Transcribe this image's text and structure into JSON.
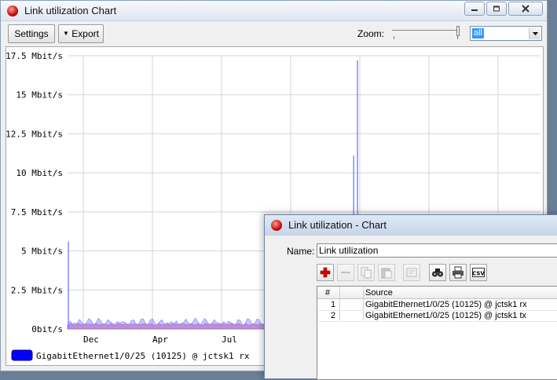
{
  "main_window": {
    "title": "Link utilization Chart",
    "toolbar": {
      "settings_label": "Settings",
      "export_label": "Export",
      "zoom_label": "Zoom:",
      "zoom_value": "all",
      "zoom_slider_fraction": 1.0
    }
  },
  "chart_data": {
    "type": "area",
    "y_tick_labels": [
      "0bit/s",
      "2.5 Mbit/s",
      "5 Mbit/s",
      "7.5 Mbit/s",
      "10 Mbit/s",
      "12.5 Mbit/s",
      "15 Mbit/s",
      "17.5 Mbit/s"
    ],
    "ylim": [
      0,
      17.5
    ],
    "y_unit": "Mbit/s",
    "x_tick_labels": [
      "Dec",
      "Apr",
      "Jul"
    ],
    "grid": true,
    "legend_position": "bottom-left",
    "legend": [
      {
        "name": "GigabitEthernet1/0/25 (10125) @ jctsk1 rx",
        "color": "#0000ff"
      }
    ],
    "series": [
      {
        "name": "GigabitEthernet1/0/25 (10125) @ jctsk1 rx",
        "color": "#7f7fff",
        "peaks": [
          {
            "x": 0.0,
            "y": 5.6
          },
          {
            "x": 0.605,
            "y": 11.1
          },
          {
            "x": 0.613,
            "y": 17.2
          }
        ],
        "baseline": 0.7
      },
      {
        "name": "GigabitEthernet1/0/25 (10125) @ jctsk1 tx",
        "color": "#e05070",
        "baseline": 0.35
      }
    ]
  },
  "dialog": {
    "title": "Link utilization - Chart",
    "name_label": "Name:",
    "name_value": "Link utilization",
    "toolbar_icons": [
      "add-icon",
      "remove-icon",
      "copy-icon",
      "paste-icon",
      "comment-icon",
      "find-icon",
      "print-icon",
      "csv-icon"
    ],
    "csv_label": "CSV",
    "table": {
      "columns": [
        "#",
        "",
        "Source"
      ],
      "rows": [
        {
          "index": "1",
          "source": "GigabitEthernet1/0/25 (10125) @ jctsk1 rx"
        },
        {
          "index": "2",
          "source": "GigabitEthernet1/0/25 (10125) @ jctsk1 tx"
        }
      ]
    }
  }
}
